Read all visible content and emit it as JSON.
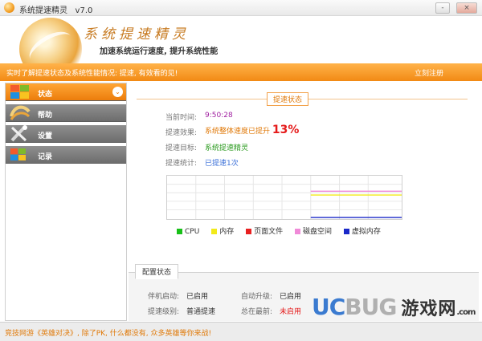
{
  "window": {
    "title": "系统提速精灵",
    "version": "v7.0",
    "min": "-",
    "max": "□",
    "close": "×"
  },
  "brand": {
    "art_text": "系统提速精灵",
    "slogan": "加速系统运行速度, 提升系统性能"
  },
  "notice": {
    "text": "实时了解提速状态及系统性能情况: 提速, 有效看的见!",
    "register": "立刻注册"
  },
  "sidebar": {
    "items": [
      {
        "label": "状态",
        "icon": "status-icon"
      },
      {
        "label": "帮助",
        "icon": "help-icon"
      },
      {
        "label": "设置",
        "icon": "settings-icon"
      },
      {
        "label": "记录",
        "icon": "record-icon"
      }
    ]
  },
  "status": {
    "caption": "提速状态",
    "rows": [
      {
        "label": "当前时间:",
        "value": "9:50:28"
      },
      {
        "label": "提速效果:",
        "value": "系统整体速度已提升",
        "percent": "13%"
      },
      {
        "label": "提速目标:",
        "value": "系统提速精灵"
      },
      {
        "label": "提速统计:",
        "value": "已提速1次"
      }
    ]
  },
  "legend": [
    {
      "name": "CPU",
      "color": "#18c018"
    },
    {
      "name": "内存",
      "color": "#f2ea1a"
    },
    {
      "name": "页面文件",
      "color": "#e82020"
    },
    {
      "name": "磁盘空间",
      "color": "#f08ad8"
    },
    {
      "name": "虚拟内存",
      "color": "#1a28c8"
    }
  ],
  "config": {
    "tab": "配置状态",
    "items": [
      {
        "label": "伴机启动:",
        "value": "已启用",
        "value_color": "#333333"
      },
      {
        "label": "自动升级:",
        "value": "已启用",
        "value_color": "#333333"
      },
      {
        "label": "提速级别:",
        "value": "普通提速",
        "value_color": "#333333"
      },
      {
        "label": "总在最前:",
        "value": "未启用",
        "value_color": "#e51a1a"
      }
    ]
  },
  "footer": {
    "text": "竞技网游《英雄对决》, 除了PK, 什么都没有, 众多英雄等你来战!"
  },
  "watermark": {
    "uc": "UC",
    "bug": "BUG",
    "cn": "游戏网",
    "dom": ".com"
  },
  "colors": {
    "accent": "#f28a14",
    "value_red": "#e51a1a",
    "value_green": "#2a9a1e",
    "time_purple": "#a020a0",
    "count_blue": "#3a6fd8"
  }
}
